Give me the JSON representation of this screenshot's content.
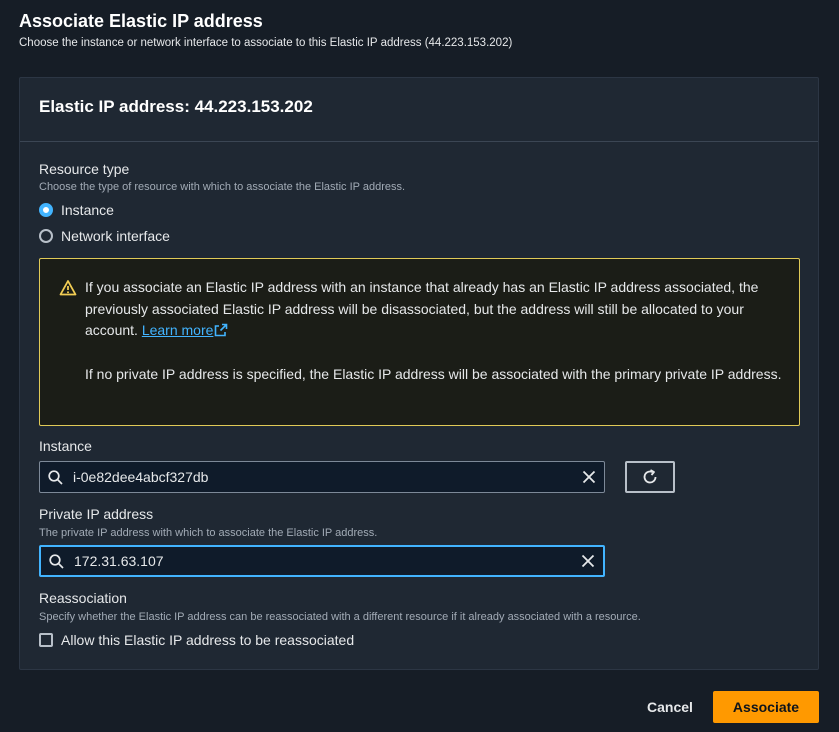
{
  "header": {
    "title": "Associate Elastic IP address",
    "description": "Choose the instance or network interface to associate to this Elastic IP address (44.223.153.202)"
  },
  "panel": {
    "title": "Elastic IP address: 44.223.153.202"
  },
  "resource_type": {
    "label": "Resource type",
    "hint": "Choose the type of resource with which to associate the Elastic IP address.",
    "options": [
      {
        "label": "Instance",
        "checked": true
      },
      {
        "label": "Network interface",
        "checked": false
      }
    ]
  },
  "alert": {
    "paragraph1": "If you associate an Elastic IP address with an instance that already has an Elastic IP address associated, the previously associated Elastic IP address will be disassociated, but the address will still be allocated to your account.",
    "link_text": "Learn more",
    "paragraph2": "If no private IP address is specified, the Elastic IP address will be associated with the primary private IP address.",
    "icon": "warning-icon",
    "border_color": "#e0ca57"
  },
  "instance": {
    "label": "Instance",
    "value": "i-0e82dee4abcf327db"
  },
  "private_ip": {
    "label": "Private IP address",
    "hint": "The private IP address with which to associate the Elastic IP address.",
    "value": "172.31.63.107"
  },
  "reassociation": {
    "label": "Reassociation",
    "hint": "Specify whether the Elastic IP address can be reassociated with a different resource if it already associated with a resource.",
    "checkbox_label": "Allow this Elastic IP address to be reassociated",
    "checked": false
  },
  "footer": {
    "cancel_label": "Cancel",
    "associate_label": "Associate"
  },
  "colors": {
    "accent": "#42b4ff",
    "primary_button": "#ff9900",
    "background": "#161d26",
    "panel": "#1f2833"
  }
}
